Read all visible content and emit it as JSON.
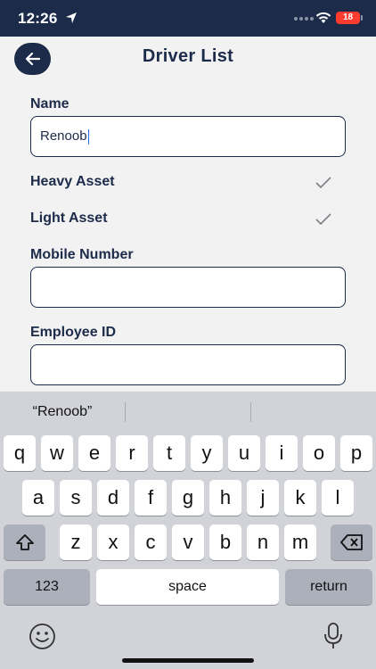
{
  "status_bar": {
    "time": "12:26",
    "battery": "18"
  },
  "header": {
    "title": "Driver List"
  },
  "form": {
    "name_label": "Name",
    "name_value": "Renoob",
    "heavy_asset_label": "Heavy Asset",
    "light_asset_label": "Light Asset",
    "mobile_label": "Mobile Number",
    "mobile_value": "",
    "employee_label": "Employee ID",
    "employee_value": ""
  },
  "keyboard": {
    "suggestion": "“Renoob”",
    "row1": [
      "q",
      "w",
      "e",
      "r",
      "t",
      "y",
      "u",
      "i",
      "o",
      "p"
    ],
    "row2": [
      "a",
      "s",
      "d",
      "f",
      "g",
      "h",
      "j",
      "k",
      "l"
    ],
    "row3": [
      "z",
      "x",
      "c",
      "v",
      "b",
      "n",
      "m"
    ],
    "numbers_label": "123",
    "space_label": "space",
    "return_label": "return"
  },
  "icons": {
    "back": "arrow-left-icon",
    "check": "checkmark-icon",
    "shift": "shift-icon",
    "delete": "backspace-icon",
    "emoji": "emoji-icon",
    "mic": "microphone-icon"
  },
  "colors": {
    "navy": "#1c2b4a",
    "battery": "#ff3b30",
    "caret": "#2f6df6"
  }
}
